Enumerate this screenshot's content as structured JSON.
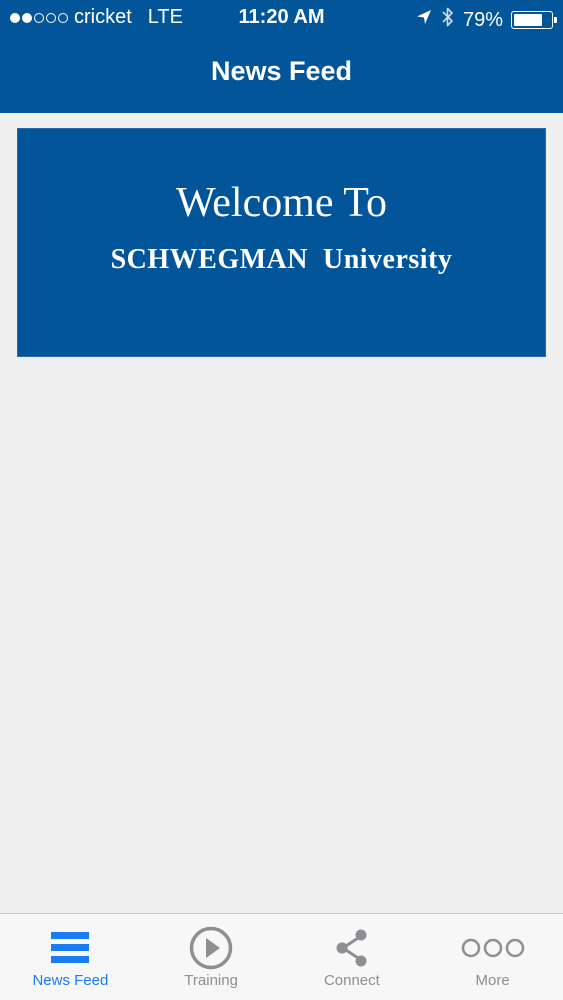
{
  "status_bar": {
    "signal_filled": 2,
    "signal_total": 5,
    "carrier": "cricket",
    "network": "LTE",
    "time": "11:20 AM",
    "battery_percent": "79%",
    "battery_level": 0.79
  },
  "nav": {
    "title": "News Feed"
  },
  "banner": {
    "title": "Welcome To",
    "subtitle": "SCHWEGMAN  University"
  },
  "tabs": [
    {
      "label": "News Feed",
      "icon": "hamburger-icon",
      "active": true
    },
    {
      "label": "Training",
      "icon": "play-circle-icon",
      "active": false
    },
    {
      "label": "Connect",
      "icon": "share-icon",
      "active": false
    },
    {
      "label": "More",
      "icon": "more-dots-icon",
      "active": false
    }
  ],
  "colors": {
    "brand_blue": "#03559a",
    "active_tab": "#1a7cf2",
    "inactive_tab": "#8e8e93",
    "background": "#efeff0"
  }
}
